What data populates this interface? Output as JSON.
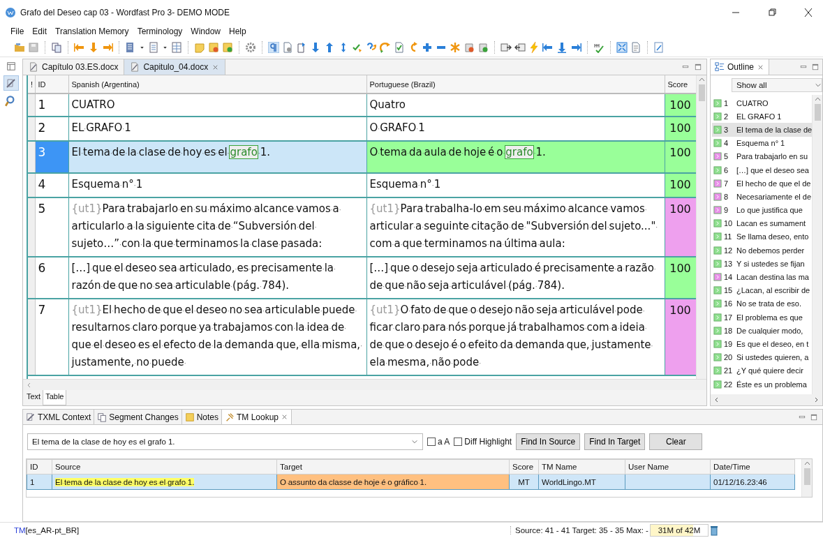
{
  "window": {
    "title": "Grafo del Deseo cap 03 - Wordfast Pro 3- DEMO MODE"
  },
  "menu": [
    "File",
    "Edit",
    "Translation Memory",
    "Terminology",
    "Window",
    "Help"
  ],
  "editor": {
    "tabs": [
      {
        "label": "Capítulo 03.ES.docx",
        "selected": false,
        "closable": false
      },
      {
        "label": "Capitulo_04.docx",
        "selected": true,
        "closable": true
      }
    ],
    "columns": [
      "!",
      "ID",
      "Spanish (Argentina)",
      "Portuguese (Brazil)",
      "Score"
    ],
    "rows": [
      {
        "id": "1",
        "selected": false,
        "score": "100",
        "color": "#99ff99",
        "source": [
          {
            "kind": "plain",
            "text": "CUATRO"
          }
        ],
        "target": [
          {
            "kind": "plain",
            "text": "Quatro"
          }
        ]
      },
      {
        "id": "2",
        "selected": false,
        "score": "100",
        "color": "#99ff99",
        "source": [
          {
            "kind": "plain",
            "text": "EL·GRAFO·1"
          }
        ],
        "target": [
          {
            "kind": "plain",
            "text": "O·GRAFO·1"
          }
        ]
      },
      {
        "id": "3",
        "selected": true,
        "score": "100",
        "color": "#99ff99",
        "source": [
          {
            "kind": "plain",
            "text": "El·tema·de·la·clase·de·hoy·es·el·"
          },
          {
            "kind": "term",
            "text": "grafo"
          },
          {
            "kind": "plain",
            "text": "·1."
          }
        ],
        "target": [
          {
            "kind": "plain",
            "text": "O·tema·da·aula·de·hoje·é·o·"
          },
          {
            "kind": "term",
            "text": "grafo"
          },
          {
            "kind": "plain",
            "text": "·1."
          }
        ]
      },
      {
        "id": "4",
        "selected": false,
        "score": "100",
        "color": "#99ff99",
        "source": [
          {
            "kind": "plain",
            "text": "Esquema·n°·1"
          }
        ],
        "target": [
          {
            "kind": "plain",
            "text": "Esquema·n°·1"
          }
        ]
      },
      {
        "id": "5",
        "selected": false,
        "score": "100",
        "color": "#eea0ee",
        "source": [
          {
            "kind": "tag",
            "text": "{ut1}"
          },
          {
            "kind": "plain",
            "text": "Para·trabajarlo·en·su·máximo·alcance·vamos·a·articularlo·a·la·siguiente·cita·de·“Subversión·del·sujeto…”·con·la·que·terminamos·la·clase·pasada:"
          }
        ],
        "target": [
          {
            "kind": "tag",
            "text": "{ut1}"
          },
          {
            "kind": "plain",
            "text": "Para·trabalha-lo·em·seu·máximo·alcance·vamos·articular·a·seguinte·citação·de·\"Subversión·del·sujeto...\"·com·a·que·terminamos·na·última·aula:"
          }
        ]
      },
      {
        "id": "6",
        "selected": false,
        "score": "100",
        "color": "#99ff99",
        "source": [
          {
            "kind": "plain",
            "text": "[…]·que·el·deseo·sea·articulado,·es·precisamente·la·razón·de·que·no·sea·articulable·(pág.·784)."
          }
        ],
        "target": [
          {
            "kind": "plain",
            "text": "[…]·que·o·desejo·seja·articulado·é·precisamente·a·razão·de·que·não·seja·articulável·(pág.·784)."
          }
        ]
      },
      {
        "id": "7",
        "selected": false,
        "score": "100",
        "color": "#eea0ee",
        "source": [
          {
            "kind": "tag",
            "text": "{ut1}"
          },
          {
            "kind": "plain",
            "text": "El·hecho·de·que·el·deseo·no·sea·articulable·puede·resultarnos·claro·porque·ya·trabajamos·con·la·idea·de·que·el·deseo·es·el·efecto·de·la·demanda·que,·ella·misma,·justamente,·no·puede·"
          }
        ],
        "target": [
          {
            "kind": "tag",
            "text": "{ut1}"
          },
          {
            "kind": "plain",
            "text": "O·fato·de·que·o·desejo·não·seja·articulável·pode·ficar·claro·para·nós·porque·já·trabalhamos·com·a·ideia·de·que·o·desejo·é·o·efeito·da·demanda·que,·justamente·ela·mesma,·não·pode·"
          }
        ]
      }
    ],
    "view_tabs": [
      {
        "label": "Text",
        "selected": false
      },
      {
        "label": "Table",
        "selected": true
      }
    ]
  },
  "outline": {
    "title": "Outline",
    "filter": "Show all",
    "items": [
      {
        "number": "1",
        "text": "CUATRO",
        "color": "#8fe08f",
        "selected": false
      },
      {
        "number": "2",
        "text": "EL GRAFO 1",
        "color": "#8fe08f",
        "selected": false
      },
      {
        "number": "3",
        "text": "El tema de la clase de",
        "color": "#8fe08f",
        "selected": true
      },
      {
        "number": "4",
        "text": "Esquema n° 1",
        "color": "#8fe08f",
        "selected": false
      },
      {
        "number": "5",
        "text": "Para trabajarlo en su",
        "color": "#e88fe8",
        "selected": false
      },
      {
        "number": "6",
        "text": "[…] que el deseo sea",
        "color": "#8fe08f",
        "selected": false
      },
      {
        "number": "7",
        "text": "El hecho de que el de",
        "color": "#e88fe8",
        "selected": false
      },
      {
        "number": "8",
        "text": "Necesariamente el de",
        "color": "#e88fe8",
        "selected": false
      },
      {
        "number": "9",
        "text": "Lo que justifica que",
        "color": "#e88fe8",
        "selected": false
      },
      {
        "number": "10",
        "text": "Lacan es sumament",
        "color": "#8fe08f",
        "selected": false
      },
      {
        "number": "11",
        "text": "Se llama deseo, ento",
        "color": "#8fe08f",
        "selected": false
      },
      {
        "number": "12",
        "text": "No debemos perder",
        "color": "#8fe08f",
        "selected": false
      },
      {
        "number": "13",
        "text": "Y si ustedes se fijan",
        "color": "#8fe08f",
        "selected": false
      },
      {
        "number": "14",
        "text": "Lacan destina las ma",
        "color": "#e88fe8",
        "selected": false
      },
      {
        "number": "15",
        "text": "¿Lacan, al escribir de",
        "color": "#8fe08f",
        "selected": false
      },
      {
        "number": "16",
        "text": "No se trata de eso.",
        "color": "#8fe08f",
        "selected": false
      },
      {
        "number": "17",
        "text": "El problema es que",
        "color": "#8fe08f",
        "selected": false
      },
      {
        "number": "18",
        "text": "De cualquier modo,",
        "color": "#8fe08f",
        "selected": false
      },
      {
        "number": "19",
        "text": "Es que el deseo, en t",
        "color": "#8fe08f",
        "selected": false
      },
      {
        "number": "20",
        "text": "Si ustedes quieren, a",
        "color": "#8fe08f",
        "selected": false
      },
      {
        "number": "21",
        "text": "¿Y qué quiere decir",
        "color": "#8fe08f",
        "selected": false
      },
      {
        "number": "22",
        "text": "Éste es un problema",
        "color": "#8fe08f",
        "selected": false
      }
    ]
  },
  "panel": {
    "tabs": [
      {
        "label": "TXML Context",
        "selected": false,
        "closable": false
      },
      {
        "label": "Segment Changes",
        "selected": false,
        "closable": false
      },
      {
        "label": "Notes",
        "selected": false,
        "closable": false
      },
      {
        "label": "TM Lookup",
        "selected": true,
        "closable": true
      }
    ],
    "search": {
      "value": "El tema de la clase de hoy es el grafo 1."
    },
    "options": [
      {
        "label": "a A",
        "checked": false
      },
      {
        "label": "Diff Highlight",
        "checked": false
      }
    ],
    "buttons": [
      "Find In Source",
      "Find In Target",
      "Clear"
    ],
    "columns": [
      "ID",
      "Source",
      "Target",
      "Score",
      "TM Name",
      "User Name",
      "Date/Time"
    ],
    "rows": [
      {
        "id": "1",
        "source": "El·tema·de·la·clase·de·hoy·es·el·grafo·1.",
        "target": "O·assunto·da·classe·de·hoje·é·o·gráfico·1.",
        "score": "MT",
        "tm_name": "WorldLingo.MT",
        "date": "01/12/16.23:46",
        "selected": true
      }
    ]
  },
  "status_bar": {
    "tm_prefix": "TM",
    "tm": "[es_AR-pt_BR]",
    "counts": "Source: 41 - 41 Target: 35 - 35 Max: -",
    "memory": {
      "text": "31M of 42M",
      "level": 0.74
    }
  }
}
